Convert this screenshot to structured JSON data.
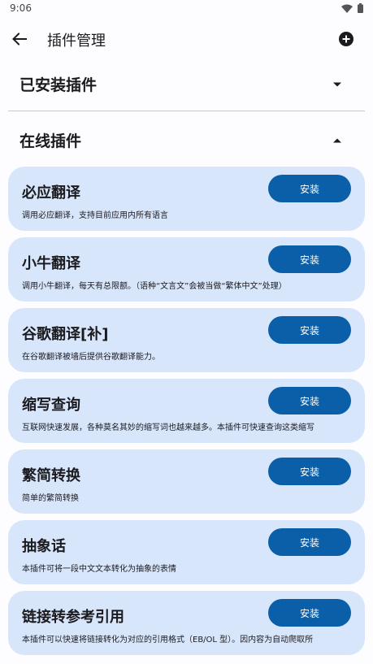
{
  "status_bar": {
    "time": "9:06"
  },
  "app_bar": {
    "title": "插件管理"
  },
  "sections": {
    "installed": {
      "title": "已安装插件"
    },
    "online": {
      "title": "在线插件"
    }
  },
  "plugins": [
    {
      "name": "必应翻译",
      "description": "调用必应翻译，支持目前应用内所有语言",
      "button": "安装"
    },
    {
      "name": "小牛翻译",
      "description": "调用小牛翻译，每天有总限额。（语种“文言文”会被当做“繁体中文”处理）",
      "button": "安装"
    },
    {
      "name": "谷歌翻译[补]",
      "description": "在谷歌翻译被墙后提供谷歌翻译能力。",
      "button": "安装"
    },
    {
      "name": "缩写查询",
      "description": "互联网快速发展，各种莫名其妙的缩写词也越来越多。本插件可快速查询这类缩写",
      "button": "安装"
    },
    {
      "name": "繁简转换",
      "description": "简单的繁简转换",
      "button": "安装"
    },
    {
      "name": "抽象话",
      "description": "本插件可将一段中文文本转化为抽象的表情",
      "button": "安装"
    },
    {
      "name": "链接转参考引用",
      "description": "本插件可以快速将链接转化为对应的引用格式（EB/OL 型）。因内容为自动爬取所",
      "button": "安装"
    }
  ],
  "icons": {
    "back": "arrow-left-icon",
    "add": "add-circle-icon",
    "wifi": "wifi-icon",
    "battery": "battery-icon",
    "collapsed": "caret-down-icon",
    "expanded": "caret-up-icon"
  },
  "colors": {
    "card_bg": "#d8e6fc",
    "button_bg": "#0a5fa8",
    "button_text": "#ffffff"
  }
}
